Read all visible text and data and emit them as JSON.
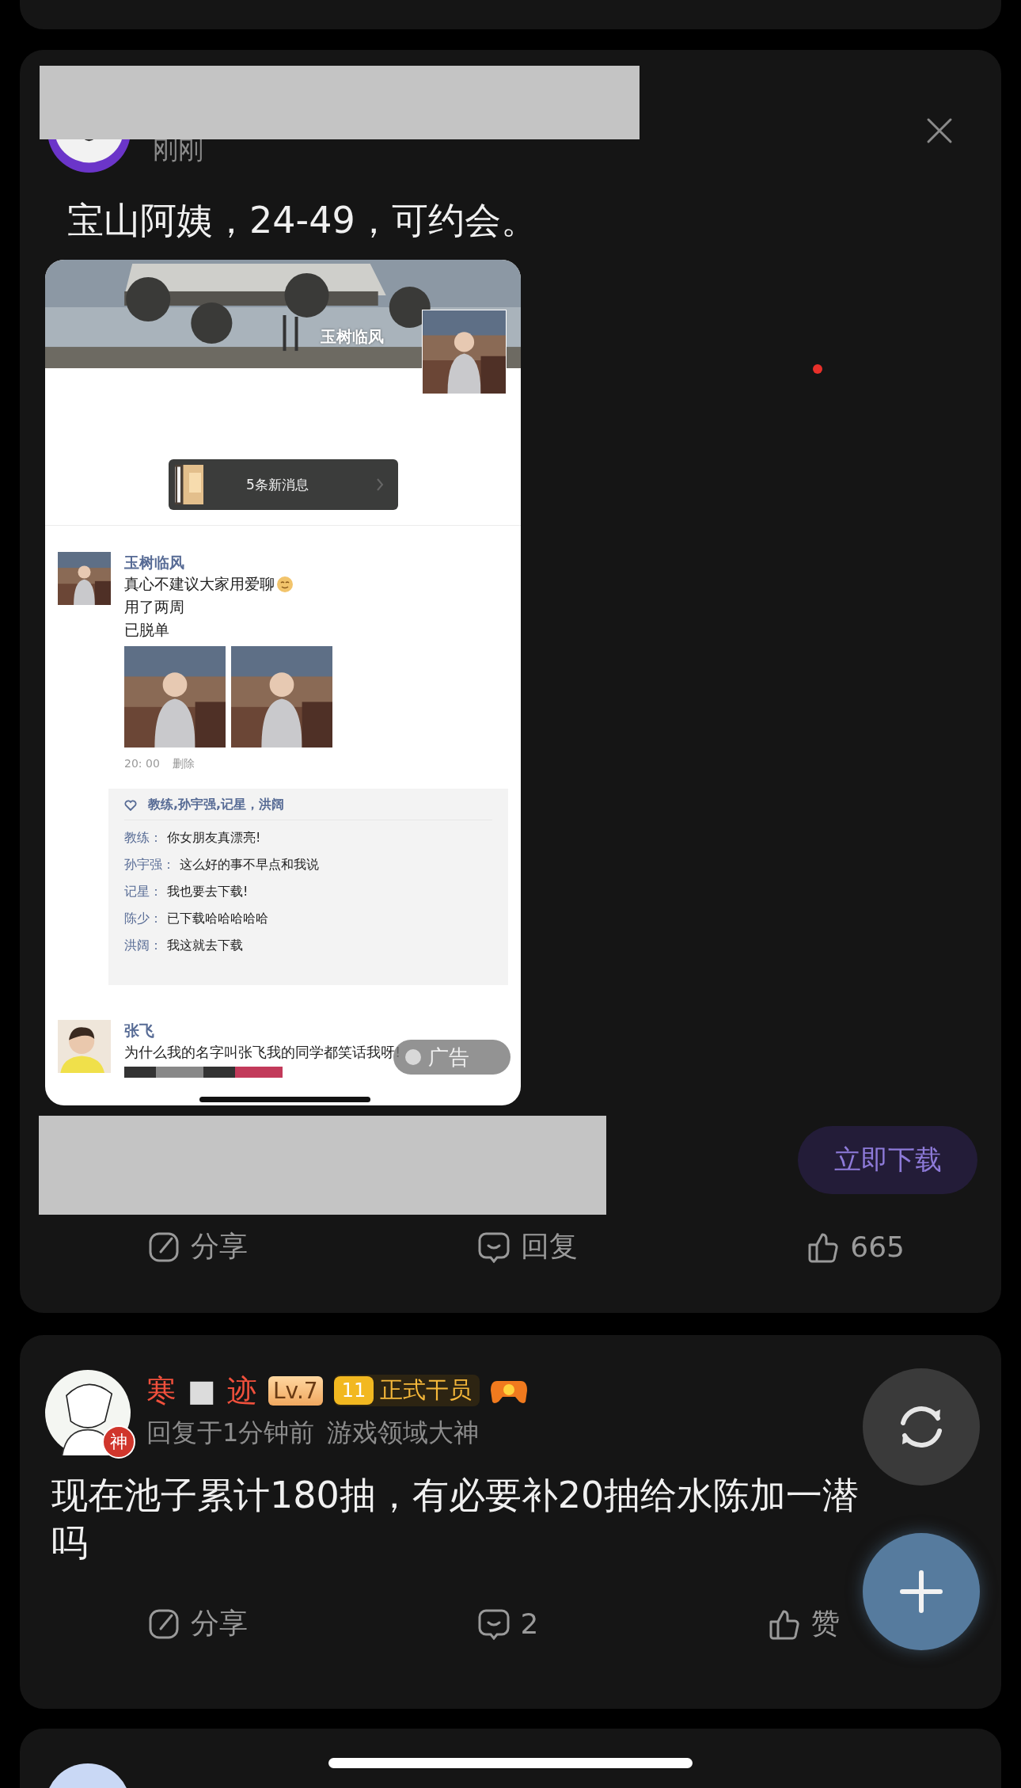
{
  "ad_post": {
    "time": "刚刚",
    "text": "宝山阿姨，24-49，可约会。",
    "ad_image": {
      "cover_name": "玉树临风",
      "new_messages": "5条新消息",
      "moment": {
        "author": "玉树临风",
        "lines": [
          "真心不建议大家用爱聊",
          "用了两周",
          "已脱单"
        ],
        "time": "20: 00",
        "delete": "删除"
      },
      "likes": "教练,孙宇强,记星，洪阔",
      "comments": [
        {
          "author": "教练：",
          "text": "你女朋友真漂亮!"
        },
        {
          "author": "孙宇强：",
          "text": "这么好的事不早点和我说"
        },
        {
          "author": "记星：",
          "text": "我也要去下载!"
        },
        {
          "author": "陈少：",
          "text": "已下载哈哈哈哈哈"
        },
        {
          "author": "洪阔：",
          "text": "我这就去下载"
        }
      ],
      "next_moment": {
        "author": "张飞",
        "text": "为什么我的名字叫张飞我的同学都笑话我呀!"
      },
      "ad_label": "广告"
    },
    "download_button": "立即下载",
    "actions": [
      {
        "kind": "share",
        "label": "分享"
      },
      {
        "kind": "reply",
        "label": "回复"
      },
      {
        "kind": "like",
        "label": "665"
      }
    ]
  },
  "reply_post": {
    "name_parts": [
      {
        "text": "寒",
        "color": "#f0503c"
      },
      {
        "text": "■",
        "color": "#dcdcdc"
      },
      {
        "text": "迹",
        "color": "#f0503c"
      }
    ],
    "level": "Lv.7",
    "rank_number": "11",
    "rank_title": "正式干员",
    "avatar_badge": "神",
    "meta": "回复于1分钟前",
    "title": "游戏领域大神",
    "text": "现在池子累计180抽，有必要补20抽给水陈加一潜吗",
    "actions": [
      {
        "kind": "share",
        "label": "分享"
      },
      {
        "kind": "reply",
        "label": "2"
      },
      {
        "kind": "like",
        "label": "赞"
      }
    ]
  }
}
